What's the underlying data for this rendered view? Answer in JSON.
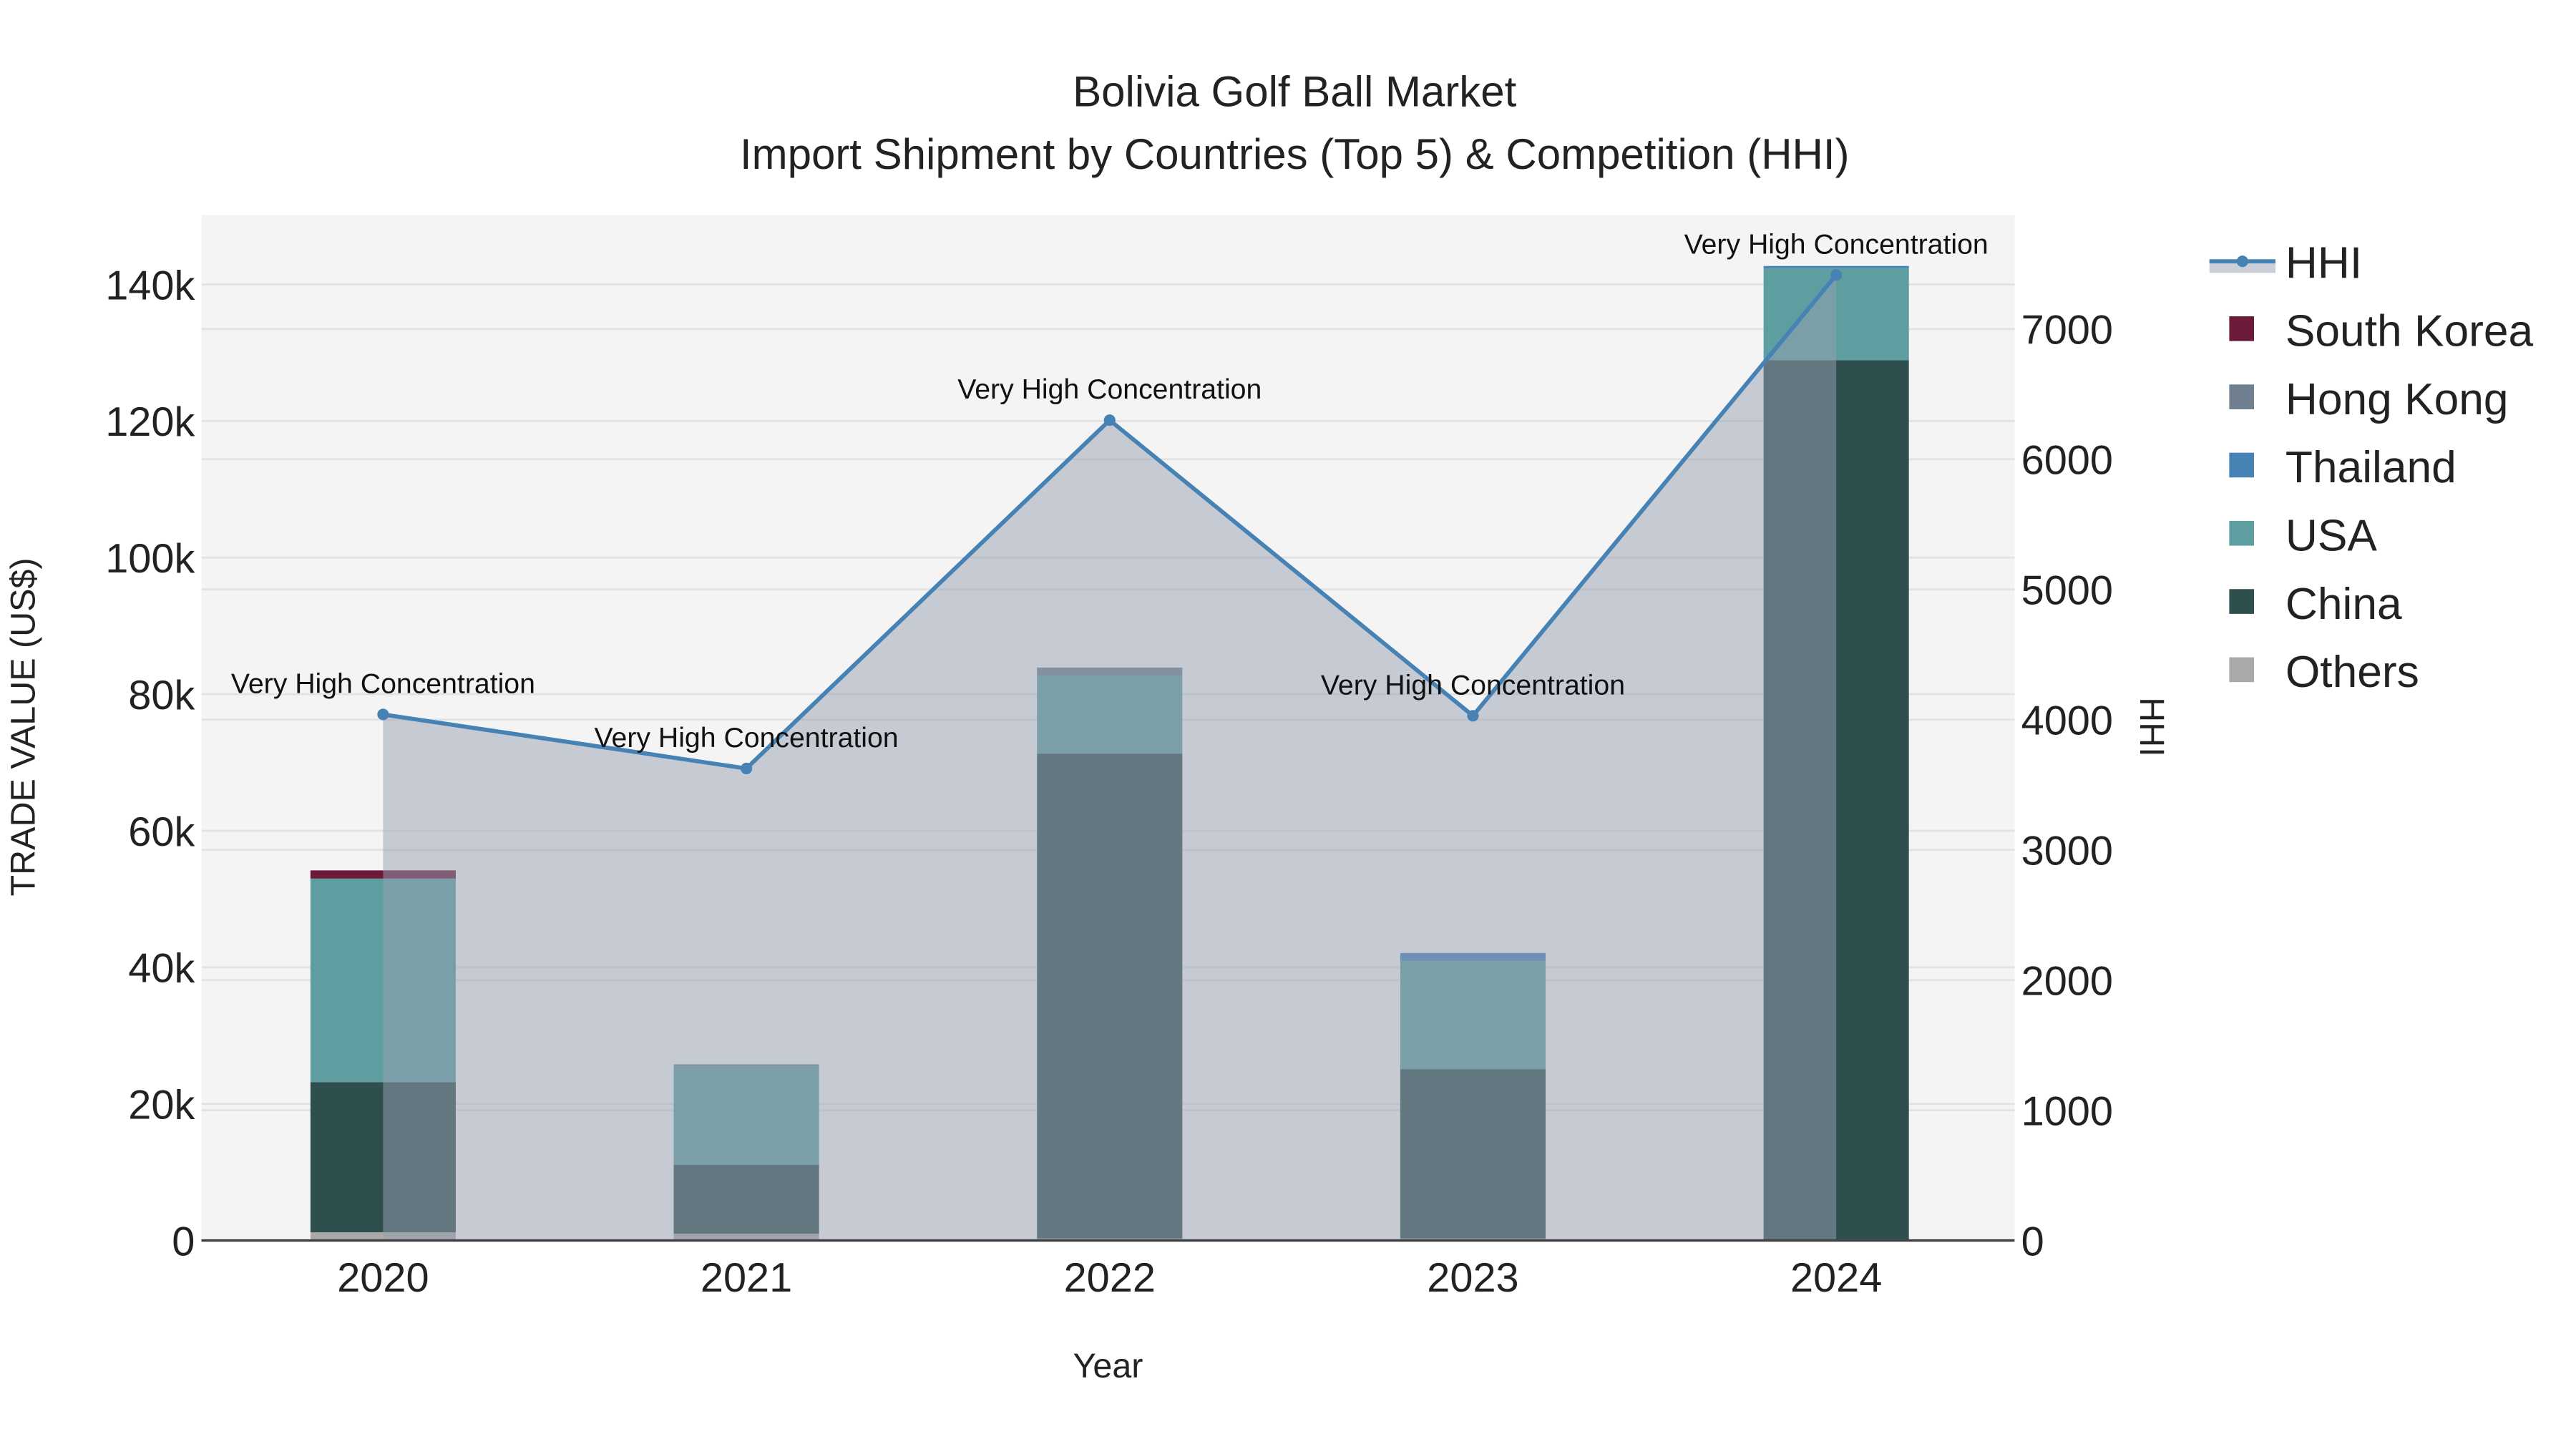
{
  "chart_data": {
    "type": "bar",
    "title": "Bolivia Golf Ball Market",
    "subtitle": "Import Shipment by Countries (Top 5) & Competition (HHI)",
    "xlabel": "Year",
    "ylabel": "TRADE VALUE (US$)",
    "y2label": "HHI",
    "categories": [
      "2020",
      "2021",
      "2022",
      "2023",
      "2024"
    ],
    "ylim": [
      0,
      150000
    ],
    "y2lim": [
      0,
      7850
    ],
    "yticks": [
      0,
      20000,
      40000,
      60000,
      80000,
      100000,
      120000,
      140000
    ],
    "ytick_labels": [
      "0",
      "20k",
      "40k",
      "60k",
      "80k",
      "100k",
      "120k",
      "140k"
    ],
    "y2ticks": [
      0,
      1000,
      2000,
      3000,
      4000,
      5000,
      6000,
      7000
    ],
    "y2tick_labels": [
      "0",
      "1000",
      "2000",
      "3000",
      "4000",
      "5000",
      "6000",
      "7000"
    ],
    "grid": true,
    "stacked": true,
    "series": [
      {
        "name": "Others",
        "color": "#a9a9a9",
        "values": [
          1200,
          1000,
          300,
          300,
          0
        ]
      },
      {
        "name": "China",
        "color": "#2f4f4f",
        "values": [
          22000,
          10100,
          71000,
          24800,
          128900
        ]
      },
      {
        "name": "USA",
        "color": "#5f9ea0",
        "values": [
          29800,
          14500,
          11400,
          15800,
          13500
        ]
      },
      {
        "name": "Thailand",
        "color": "#4682b4",
        "values": [
          0,
          0,
          0,
          1200,
          300
        ]
      },
      {
        "name": "Hong Kong",
        "color": "#708090",
        "values": [
          0,
          200,
          1200,
          0,
          0
        ]
      },
      {
        "name": "South Korea",
        "color": "#6b1a3a",
        "values": [
          1200,
          0,
          0,
          0,
          0
        ]
      }
    ],
    "hhi": {
      "name": "HHI",
      "color": "#4682b4",
      "values": [
        4040,
        3625,
        6300,
        4030,
        7415
      ]
    },
    "annotations": [
      "Very High Concentration",
      "Very High Concentration",
      "Very High Concentration",
      "Very High Concentration",
      "Very High Concentration"
    ],
    "legend_order": [
      "HHI",
      "South Korea",
      "Hong Kong",
      "Thailand",
      "USA",
      "China",
      "Others"
    ],
    "legend_position": "right"
  }
}
